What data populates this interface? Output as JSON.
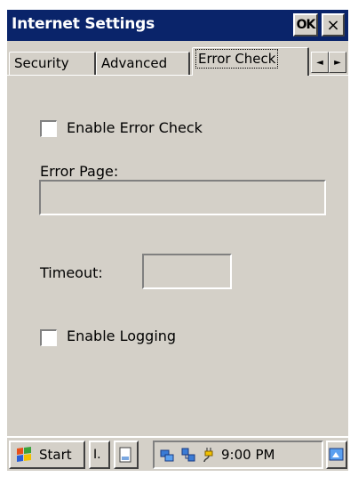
{
  "window": {
    "title": "Internet Settings",
    "ok_label": "OK",
    "close_label": "×",
    "title_bar_color": "#0a246a",
    "face_color": "#d4d0c8"
  },
  "tabs": [
    {
      "label": "Security",
      "active": false
    },
    {
      "label": "Advanced",
      "active": false
    },
    {
      "label": "Error Check",
      "active": true
    }
  ],
  "tab_scroll": {
    "left": "◄",
    "right": "►"
  },
  "panel": {
    "enable_error_check": {
      "label": "Enable Error Check",
      "checked": false
    },
    "error_page": {
      "label": "Error Page:",
      "value": "",
      "disabled": true
    },
    "timeout": {
      "label": "Timeout:",
      "value": "",
      "disabled": true
    },
    "enable_logging": {
      "label": "Enable Logging",
      "checked": false
    }
  },
  "taskbar": {
    "start_label": "Start",
    "task_items": [
      "I."
    ],
    "tray_icons": [
      "network-icon",
      "connection-icon",
      "power-plug-icon"
    ],
    "clock": "9:00 PM",
    "desktop_icon": "show-desktop-icon"
  }
}
